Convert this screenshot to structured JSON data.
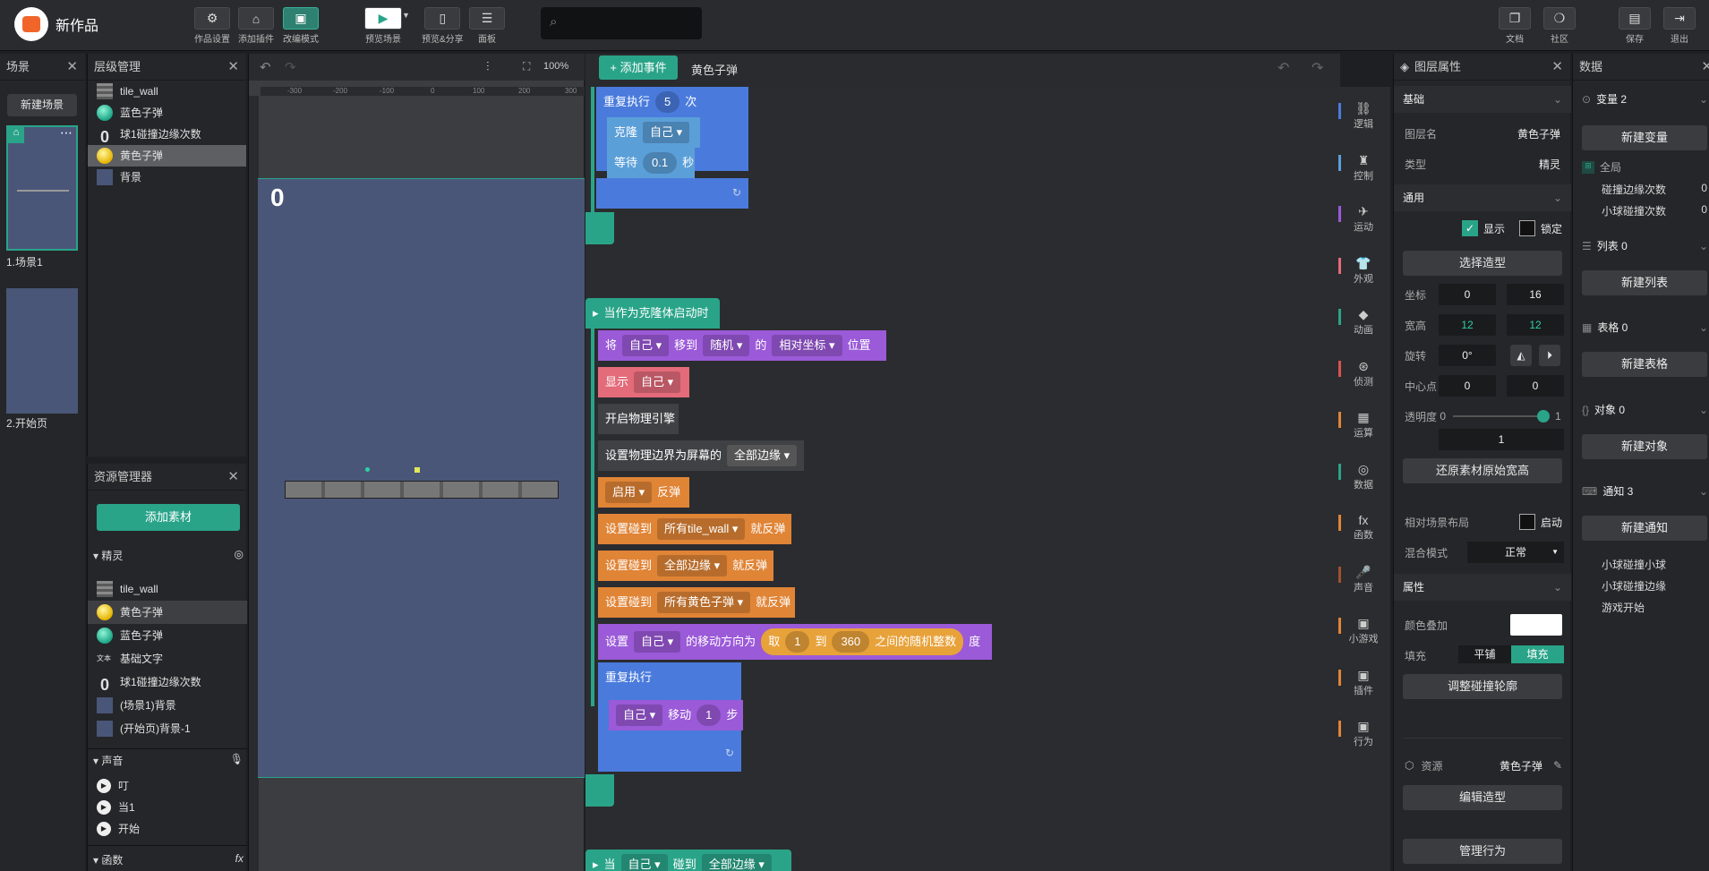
{
  "app": {
    "title": "新作品"
  },
  "toolbar": {
    "settings": "作品设置",
    "add_plugin": "添加插件",
    "edit_mode": "改编模式",
    "preview": "预览场景",
    "preview_share": "预览&分享",
    "panel": "面板",
    "docs": "文档",
    "community": "社区",
    "save": "保存",
    "exit": "退出"
  },
  "scenes": {
    "title": "场景",
    "new_button": "新建场景",
    "items": [
      {
        "label": "1.场景1"
      },
      {
        "label": "2.开始页"
      }
    ]
  },
  "layers": {
    "title": "层级管理",
    "items": [
      {
        "label": "tile_wall",
        "icon": "tile-wall-thumb"
      },
      {
        "label": "蓝色子弹",
        "icon": "blue-ball-thumb"
      },
      {
        "label": "球1碰撞边缘次数",
        "icon": "number-text-thumb"
      },
      {
        "label": "黄色子弹",
        "icon": "yellow-ball-thumb"
      },
      {
        "label": "背景",
        "icon": "background-thumb"
      }
    ]
  },
  "stage": {
    "zoom": "100%",
    "score": "0",
    "ruler_ticks": [
      "-300",
      "-200",
      "-100",
      "0",
      "100",
      "200",
      "300"
    ]
  },
  "assets": {
    "title": "资源管理器",
    "add_button": "添加素材",
    "sprites_label": "精灵",
    "sprites": [
      "tile_wall",
      "黄色子弹",
      "蓝色子弹",
      "基础文字",
      "球1碰撞边缘次数",
      "(场景1)背景",
      "(开始页)背景-1"
    ],
    "sound_label": "声音",
    "sounds": [
      "叮",
      "当1",
      "开始"
    ],
    "functions_label": "函数"
  },
  "editor": {
    "add_event": "添加事件",
    "sprite_name": "黄色子弹",
    "blocks": {
      "repeat": "重复执行",
      "repeat_count": "5",
      "times": "次",
      "clone": "克隆",
      "self": "自己",
      "wait": "等待",
      "wait_value": "0.1",
      "seconds": "秒",
      "when_clone": "当作为克隆体启动时",
      "move_to_a": "将",
      "move_to_b": "移到",
      "random": "随机",
      "of": "的",
      "relative": "相对坐标",
      "position": "位置",
      "show": "显示",
      "physics": "开启物理引擎",
      "set_bound": "设置物理边界为屏幕的",
      "all_edges": "全部边缘",
      "enable": "启用",
      "bounce": "反弹",
      "set_hit": "设置碰到",
      "all_tile": "所有tile_wall",
      "then_bounce": "就反弹",
      "all_yellow": "所有黄色子弹",
      "set": "设置",
      "move_dir": "的移动方向为",
      "take": "取",
      "from_v": "1",
      "to": "到",
      "to_v": "360",
      "random_int": "之间的随机整数",
      "deg": "度",
      "repeat_forever": "重复执行",
      "move": "移动",
      "step_v": "1",
      "steps": "步",
      "when_hit": "当",
      "hit": "碰到"
    }
  },
  "categories": [
    {
      "label": "逻辑",
      "color": "#4a7bdc"
    },
    {
      "label": "控制",
      "color": "#5b9fd8"
    },
    {
      "label": "运动",
      "color": "#9b5ad8"
    },
    {
      "label": "外观",
      "color": "#e36b7a"
    },
    {
      "label": "动画",
      "color": "#2aa489"
    },
    {
      "label": "侦测",
      "color": "#d9534f"
    },
    {
      "label": "运算",
      "color": "#e08436"
    },
    {
      "label": "数据",
      "color": "#2aa489"
    },
    {
      "label": "函数",
      "color": "#e08436"
    },
    {
      "label": "声音",
      "color": "#a0522d"
    },
    {
      "label": "小游戏",
      "color": "#e08436"
    },
    {
      "label": "插件",
      "color": "#e08436"
    },
    {
      "label": "行为",
      "color": "#e08436"
    }
  ],
  "props": {
    "title": "图层属性",
    "basic": "基础",
    "layer_name_label": "图层名",
    "layer_name": "黄色子弹",
    "type_label": "类型",
    "type": "精灵",
    "general": "通用",
    "show": "显示",
    "lock": "锁定",
    "choose_costume": "选择造型",
    "coord_label": "坐标",
    "x": "0",
    "y": "16",
    "size_label": "宽高",
    "w": "12",
    "h": "12",
    "rotate_label": "旋转",
    "rotate": "0°",
    "center_label": "中心点",
    "cx": "0",
    "cy": "0",
    "opacity_label": "透明度",
    "op_min": "0",
    "op_max": "1",
    "opacity": "1",
    "restore_size": "还原素材原始宽高",
    "relative_layout": "相对场景布局",
    "enable": "启动",
    "blend_label": "混合模式",
    "blend": "正常",
    "attributes": "属性",
    "color_overlay": "颜色叠加",
    "fill_label": "填充",
    "tile": "平铺",
    "fill": "填充",
    "adjust_collision": "调整碰撞轮廓",
    "resource_label": "资源",
    "resource": "黄色子弹",
    "edit_costume": "编辑造型",
    "manage_behavior": "管理行为"
  },
  "data": {
    "title": "数据",
    "variables": "变量 2",
    "new_variable": "新建变量",
    "global": "全局",
    "var_items": [
      {
        "name": "碰撞边缘次数",
        "value": "0"
      },
      {
        "name": "小球碰撞次数",
        "value": "0"
      }
    ],
    "lists": "列表 0",
    "new_list": "新建列表",
    "tables": "表格 0",
    "new_table": "新建表格",
    "objects": "对象 0",
    "new_object": "新建对象",
    "notices": "通知 3",
    "new_notice": "新建通知",
    "notice_items": [
      "小球碰撞小球",
      "小球碰撞边缘",
      "游戏开始"
    ]
  }
}
